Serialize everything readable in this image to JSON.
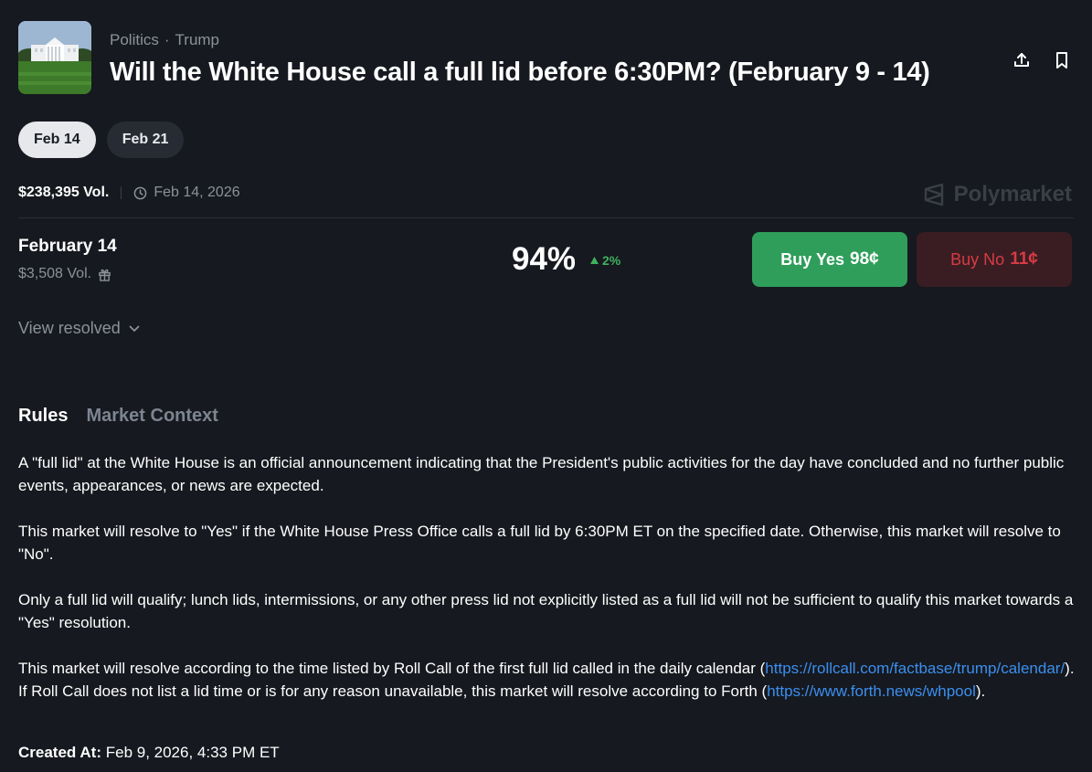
{
  "header": {
    "category": "Politics",
    "separator": "·",
    "subcategory": "Trump",
    "title": "Will the White House call a full lid before 6:30PM? (February 9 - 14)",
    "thumbnail_icon": "white-house-photo",
    "share_icon": "share-icon",
    "bookmark_icon": "bookmark-icon"
  },
  "date_pills": [
    {
      "label": "Feb 14",
      "active": true
    },
    {
      "label": "Feb 21",
      "active": false
    }
  ],
  "meta": {
    "volume": "$238,395 Vol.",
    "end_date": "Feb 14, 2026",
    "brand": "Polymarket"
  },
  "outcome": {
    "name": "February 14",
    "volume": "$3,508 Vol.",
    "probability": "94%",
    "change": "2%",
    "yes_label": "Buy Yes",
    "yes_price": "98¢",
    "no_label": "Buy No",
    "no_price": "11¢"
  },
  "view_resolved": "View resolved",
  "tabs": [
    {
      "label": "Rules",
      "active": true
    },
    {
      "label": "Market Context",
      "active": false
    }
  ],
  "rules": {
    "p1": "A \"full lid\" at the White House is an official announcement indicating that the President's public activities for the day have concluded and no further public events, appearances, or news are expected.",
    "p2": "This market will resolve to \"Yes\" if the White House Press Office calls a full lid by 6:30PM ET on the specified date. Otherwise, this market will resolve to \"No\".",
    "p3": "Only a full lid will qualify; lunch lids, intermissions, or any other press lid not explicitly listed as a full lid will not be sufficient to qualify this market towards a \"Yes\" resolution.",
    "p4_a": "This market will resolve according to the time listed by Roll Call of the first full lid called in the daily calendar (",
    "p4_link1": "https://rollcall.com/factbase/trump/calendar/",
    "p4_b": "). If Roll Call does not list a lid time or is for any reason unavailable, this market will resolve according to Forth (",
    "p4_link2": "https://www.forth.news/whpool",
    "p4_c": ")."
  },
  "created": {
    "label": "Created At:",
    "value": "Feb 9, 2026, 4:33 PM ET"
  },
  "colors": {
    "background": "#16191f",
    "yes_green": "#2f9e5a",
    "no_red": "#d63b45",
    "link_blue": "#3b8ff0",
    "muted": "#8b929c"
  }
}
